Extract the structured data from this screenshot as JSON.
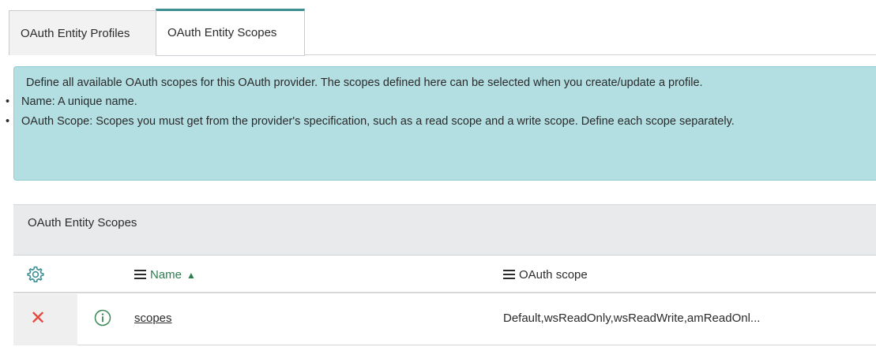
{
  "tabs": [
    {
      "label": "OAuth Entity Profiles",
      "active": false
    },
    {
      "label": "OAuth Entity Scopes",
      "active": true
    }
  ],
  "info": {
    "description": "Define all available OAuth scopes for this OAuth provider. The scopes defined here can be selected when you create/update a profile.",
    "bullets": [
      {
        "label": "Name:",
        "text": " A unique name."
      },
      {
        "label": "OAuth Scope:",
        "text": " Scopes you must get from the provider's specification, such as a read scope and a write scope. Define each scope separately."
      }
    ]
  },
  "list": {
    "title": "OAuth Entity Scopes",
    "columns": {
      "name": "Name",
      "scope": "OAuth scope"
    },
    "sort": {
      "column": "name",
      "direction": "ascending"
    },
    "rows": [
      {
        "name": "scopes",
        "scope": "Default,wsReadOnly,wsReadWrite,amReadOnl..."
      }
    ]
  },
  "colors": {
    "accent": "#3c8f95",
    "info_bg": "#b3dfe3",
    "sort_green": "#2f7d4f",
    "delete_red": "#e5473b"
  },
  "icons": {
    "settings": "gear-icon",
    "delete": "close-icon",
    "info": "info-circle-icon",
    "column_menu": "hamburger-menu-icon",
    "sort": "sort-up-triangle-icon"
  }
}
